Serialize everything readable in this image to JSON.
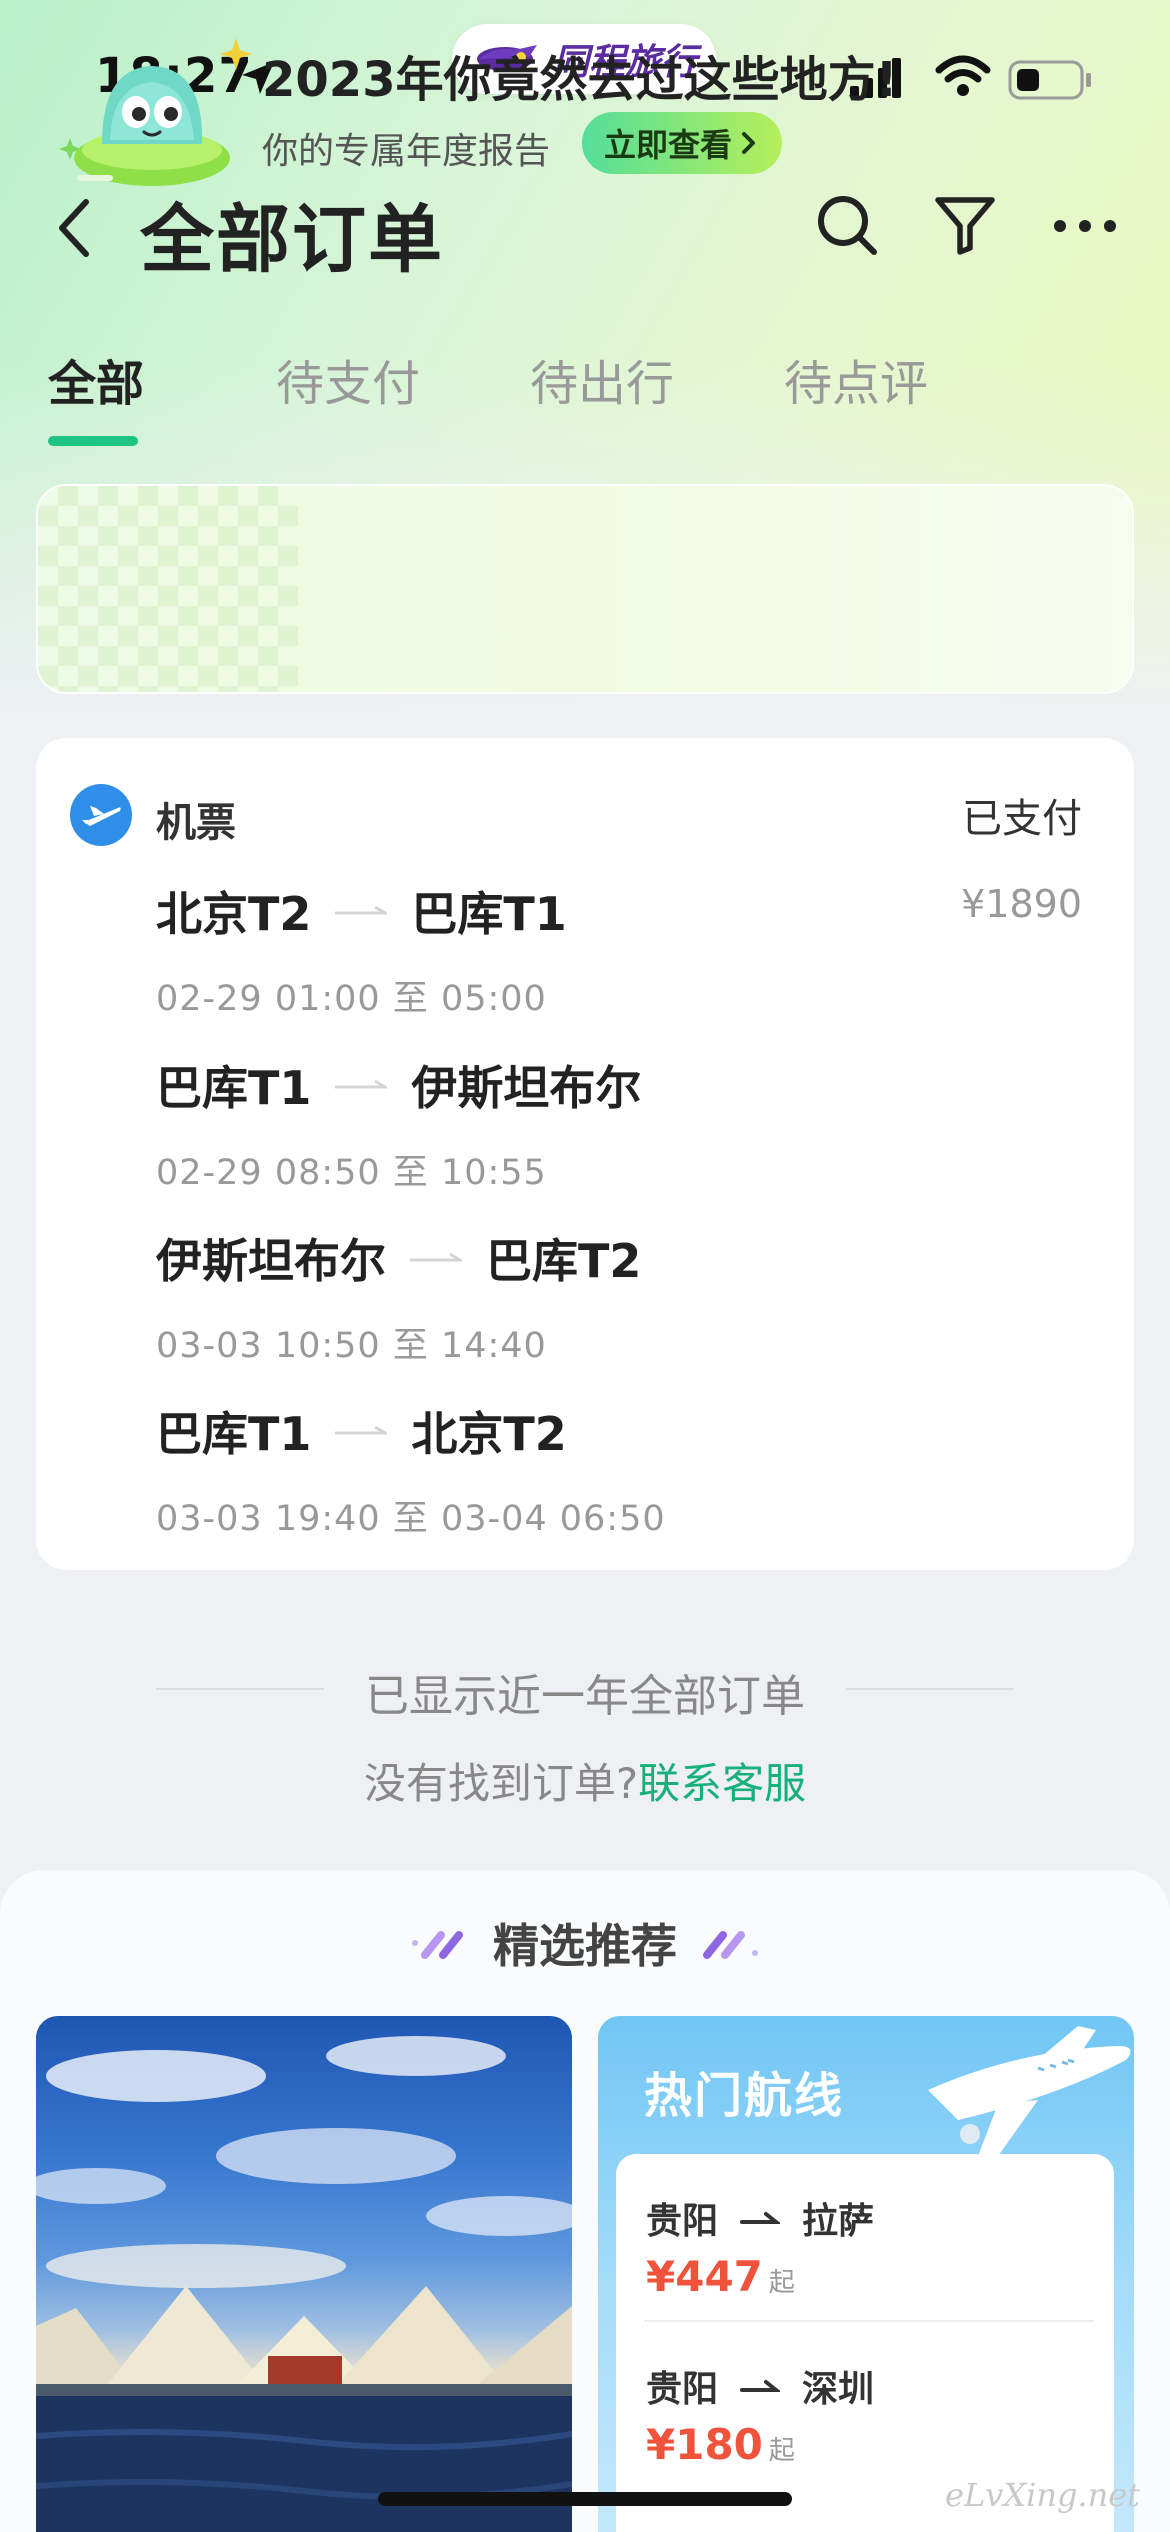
{
  "status_bar": {
    "time": "18:27",
    "brand": "同程旅行"
  },
  "header": {
    "title": "全部订单",
    "icons": [
      "back-icon",
      "search-icon",
      "filter-icon",
      "more-icon"
    ]
  },
  "tabs": [
    {
      "label": "全部",
      "active": true
    },
    {
      "label": "待支付",
      "active": false
    },
    {
      "label": "待出行",
      "active": false
    },
    {
      "label": "待点评",
      "active": false
    }
  ],
  "banner": {
    "title": "2023年你竟然去过这些地方!",
    "subtitle": "你的专属年度报告",
    "button": "立即查看"
  },
  "order": {
    "category": "机票",
    "status": "已支付",
    "price": "¥1890",
    "segments": [
      {
        "from": "北京T2",
        "to": "巴库T1",
        "time": "02-29 01:00 至 05:00"
      },
      {
        "from": "巴库T1",
        "to": "伊斯坦布尔",
        "time": "02-29 08:50 至 10:55"
      },
      {
        "from": "伊斯坦布尔",
        "to": "巴库T2",
        "time": "03-03 10:50 至 14:40"
      },
      {
        "from": "巴库T1",
        "to": "北京T2",
        "time": "03-03 19:40 至 03-04 06:50"
      }
    ]
  },
  "footer": {
    "shown_all": "已显示近一年全部订单",
    "not_found": "没有找到订单?",
    "contact": "联系客服"
  },
  "recommend": {
    "title": "精选推荐",
    "hot_title": "热门航线",
    "routes": [
      {
        "from": "贵阳",
        "to": "拉萨",
        "price": "¥447",
        "suffix": "起"
      },
      {
        "from": "贵阳",
        "to": "深圳",
        "price": "¥180",
        "suffix": "起"
      }
    ]
  },
  "watermark": "eLvXing.net",
  "colors": {
    "accent_green": "#1fc484",
    "link_green": "#17b07a",
    "price_red": "#f0533c",
    "brand_purple": "#5a2ca0"
  }
}
